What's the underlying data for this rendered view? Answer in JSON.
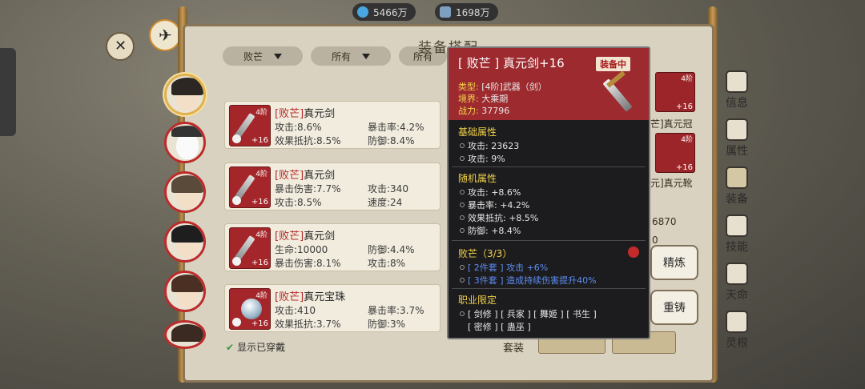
{
  "currency": {
    "jade": "5466万",
    "spirit": "1698万"
  },
  "panel": {
    "title": "装备搭配"
  },
  "filters": [
    "败芒",
    "所有",
    "所有"
  ],
  "items": [
    {
      "tier": "4阶",
      "level": "+16",
      "quality": "[败芒]",
      "name": "真元剑",
      "stats": [
        "攻击:8.6%",
        "暴击率:4.2%",
        "效果抵抗:8.5%",
        "防御:8.4%"
      ]
    },
    {
      "tier": "4阶",
      "level": "+16",
      "quality": "[败芒]",
      "name": "真元剑",
      "stats": [
        "暴击伤害:7.7%",
        "攻击:340",
        "攻击:8.5%",
        "速度:24"
      ]
    },
    {
      "tier": "4阶",
      "level": "+16",
      "quality": "[败芒]",
      "name": "真元剑",
      "stats": [
        "生命:10000",
        "防御:4.4%",
        "暴击伤害:8.1%",
        "攻击:8%"
      ]
    },
    {
      "tier": "4阶",
      "level": "+16",
      "quality": "[败芒]",
      "name": "真元宝珠",
      "stats": [
        "攻击:410",
        "暴击率:3.7%",
        "效果抵抗:3.7%",
        "防御:3%"
      ]
    }
  ],
  "show_worn": "显示已穿戴",
  "tooltip": {
    "title": "[ 败芒 ] 真元剑+16",
    "badge": "装备中",
    "type_k": "类型:",
    "type_v": "[4阶]武器（剑）",
    "realm_k": "境界:",
    "realm_v": "大乘期",
    "power_k": "战力:",
    "power_v": "37796",
    "base_h": "基础属性",
    "base": [
      "攻击:  23623",
      "攻击:  9%"
    ],
    "random_h": "随机属性",
    "random": [
      "攻击:  +8.6%",
      "暴击率:  +4.2%",
      "效果抵抗:  +8.5%",
      "防御:  +8.4%"
    ],
    "set_h": "败芒（3/3）",
    "set": [
      "[ 2件套 ] 攻击 +6%",
      "[ 3件套 ] 造成持续伤害提升40%"
    ],
    "job_h": "职业限定",
    "job1": "[ 剑修 ] [ 兵家 ] [ 舞姬 ] [ 书生 ]",
    "job2": "[ 密修 ] [ 蛊巫 ]"
  },
  "actions": {
    "refine": "精炼",
    "recast": "重铸"
  },
  "side_tabs": [
    "信息",
    "属性",
    "装备",
    "技能",
    "天命",
    "灵根"
  ],
  "behind": {
    "slot_level1": "+16",
    "slot_level2": "+16",
    "label1": "芒]真元冠",
    "label2": "元]真元靴",
    "tier1": "4阶",
    "tier2": "4阶",
    "num1": "6870",
    "num2": "0",
    "set_label": "套装"
  }
}
